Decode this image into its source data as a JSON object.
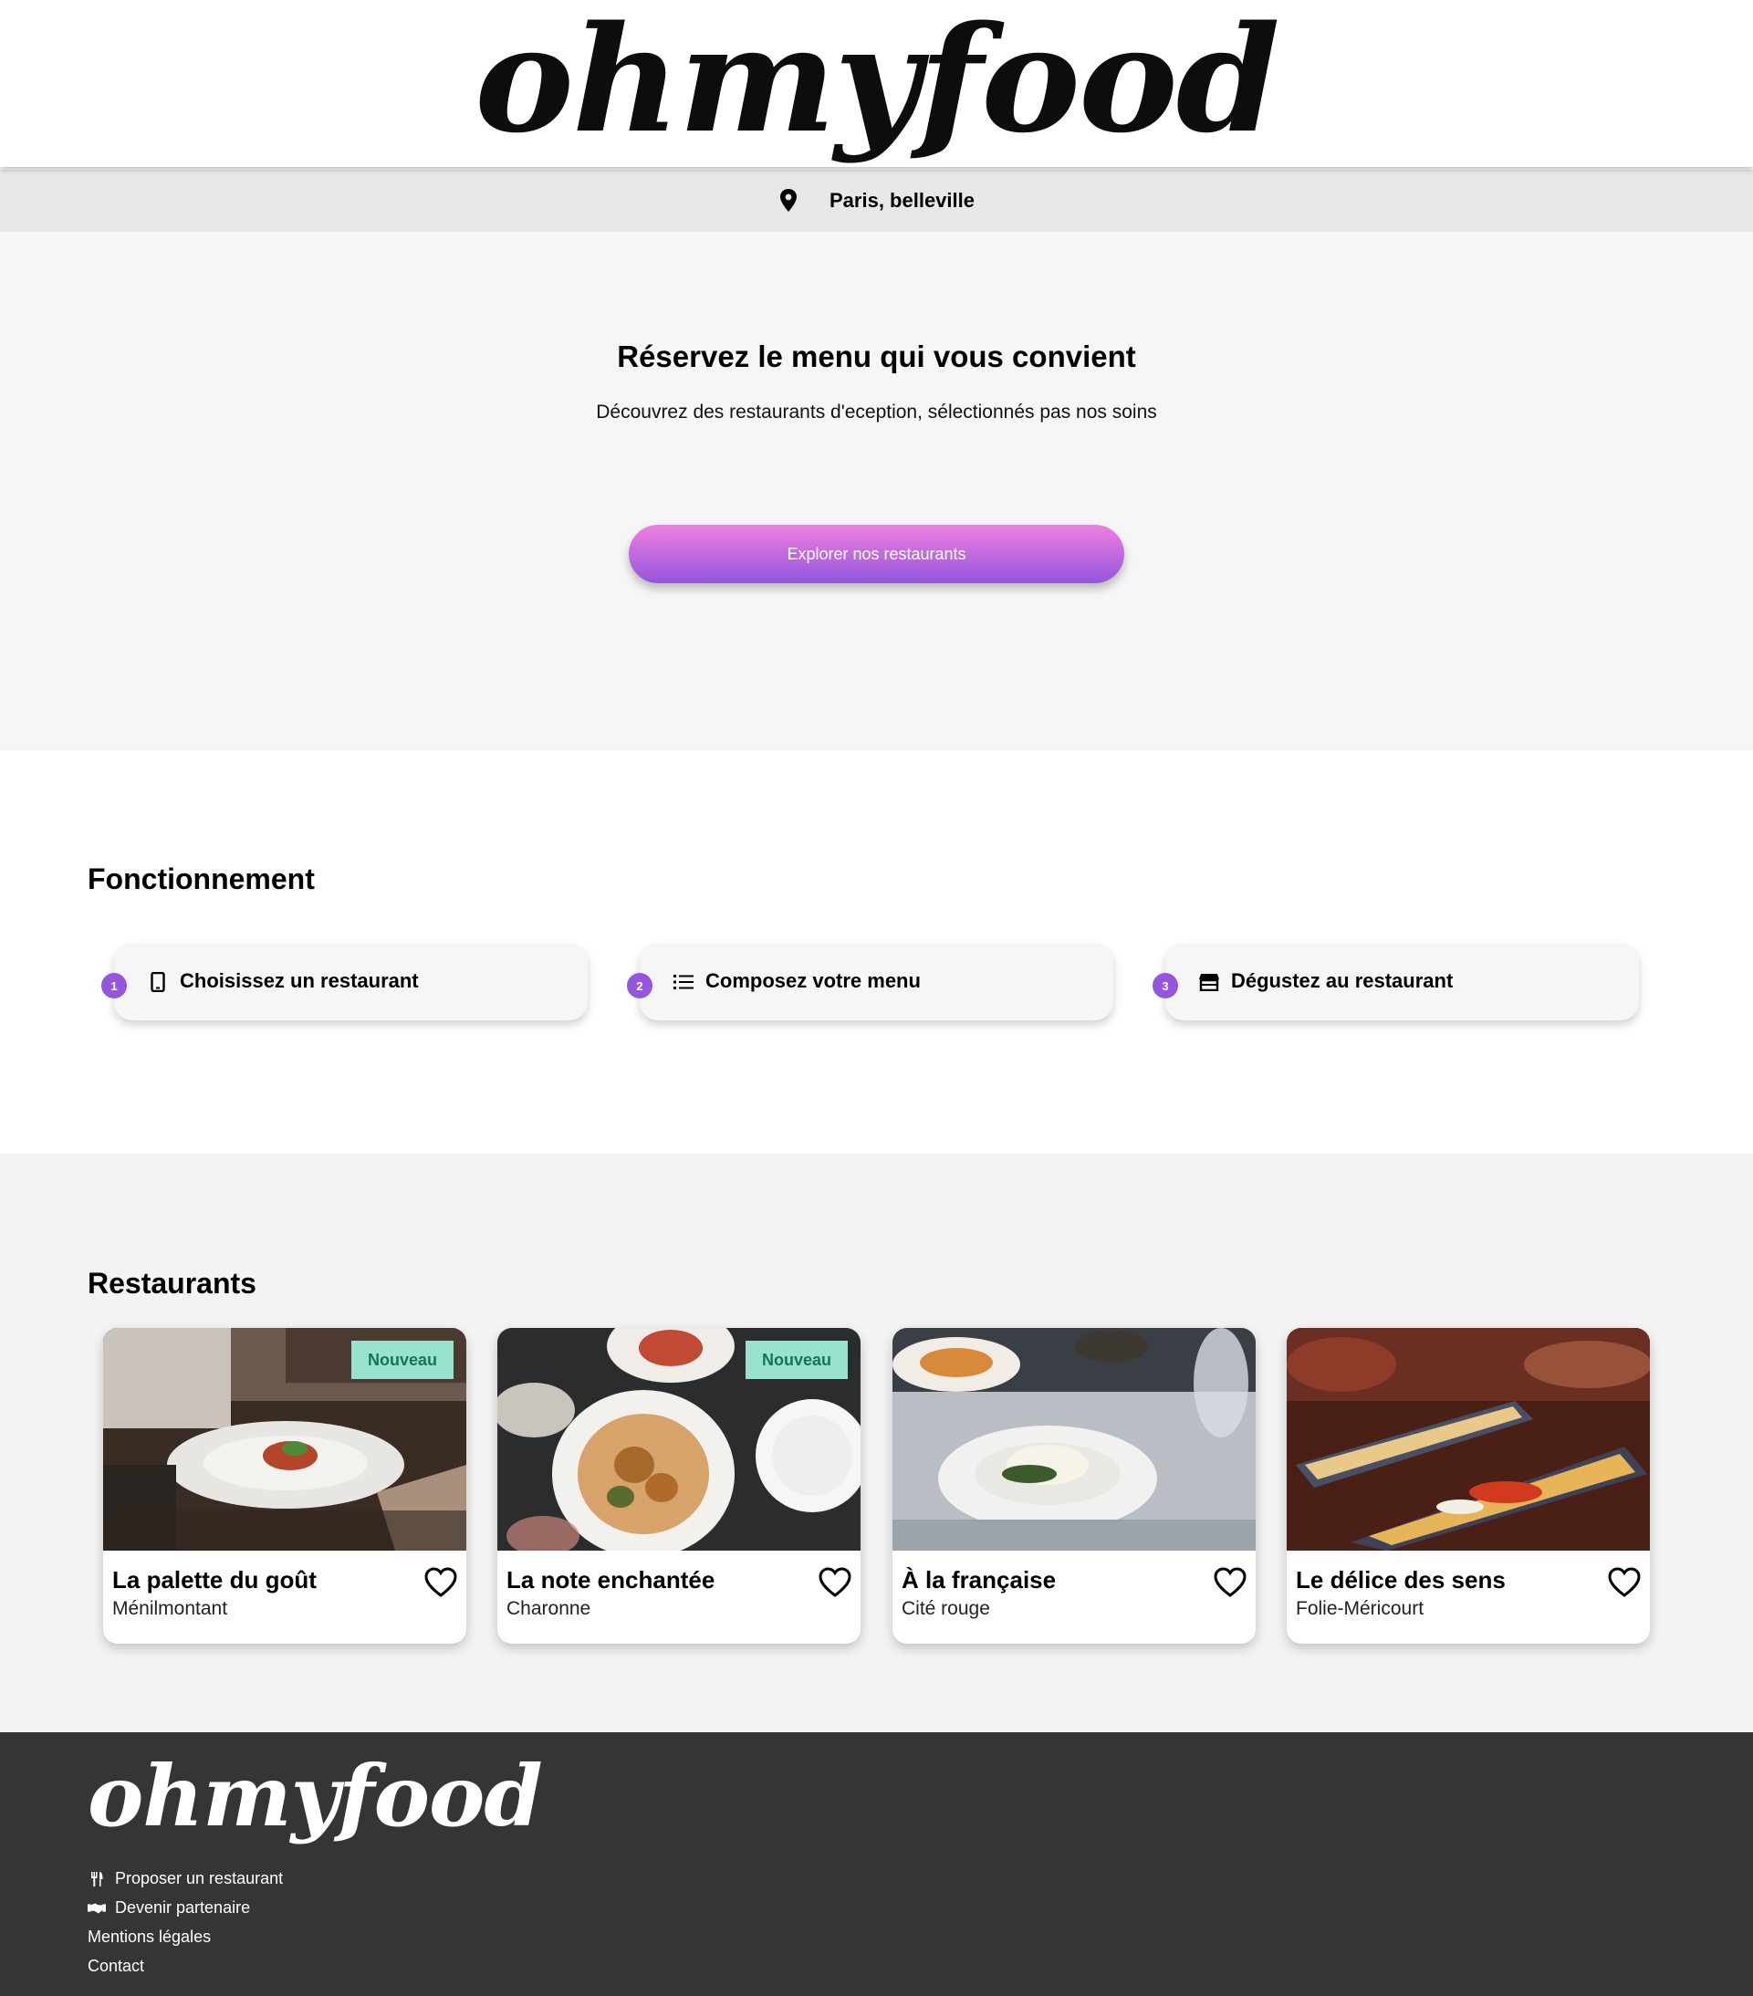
{
  "header": {
    "logo_text": "ohmyfood",
    "location": "Paris, belleville",
    "location_icon": "map-pin-icon"
  },
  "hero": {
    "title": "Réservez le menu qui vous convient",
    "subtitle": "Découvrez des restaurants d'eception, sélectionnés pas nos soins",
    "cta_label": "Explorer nos restaurants",
    "cta_colors": [
      "#f07fe0",
      "#9356dc"
    ]
  },
  "fonctionnement": {
    "title": "Fonctionnement",
    "steps": [
      {
        "number": "1",
        "label": "Choisissez un restaurant",
        "icon": "mobile-phone-icon"
      },
      {
        "number": "2",
        "label": "Composez votre menu",
        "icon": "list-icon"
      },
      {
        "number": "3",
        "label": "Dégustez au restaurant",
        "icon": "store-icon"
      }
    ],
    "accent_color": "#9356dc"
  },
  "restaurants": {
    "title": "Restaurants",
    "items": [
      {
        "name": "La palette du goût",
        "area": "Ménilmontant",
        "badge": "Nouveau"
      },
      {
        "name": "La note enchantée",
        "area": "Charonne",
        "badge": "Nouveau"
      },
      {
        "name": "À la française",
        "area": "Cité rouge",
        "badge": ""
      },
      {
        "name": "Le délice des sens",
        "area": "Folie-Méricourt",
        "badge": ""
      }
    ],
    "badge_color": "#99e2d0",
    "heart_icon": "heart-outline-icon"
  },
  "footer": {
    "logo_text": "ohmyfood",
    "links": [
      {
        "label": "Proposer un restaurant",
        "icon": "utensils-icon"
      },
      {
        "label": "Devenir partenaire",
        "icon": "handshake-icon"
      },
      {
        "label": "Mentions légales",
        "icon": ""
      },
      {
        "label": "Contact",
        "icon": ""
      }
    ]
  }
}
